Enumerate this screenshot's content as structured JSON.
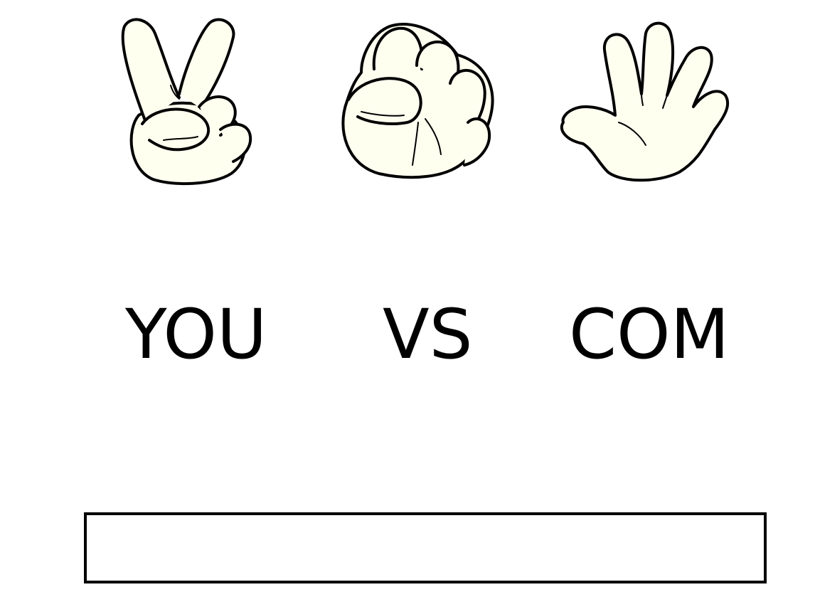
{
  "choices": [
    {
      "id": "scissors",
      "icon": "scissors-hand-icon"
    },
    {
      "id": "rock",
      "icon": "rock-fist-icon"
    },
    {
      "id": "paper",
      "icon": "paper-open-hand-icon"
    }
  ],
  "labels": {
    "you": "YOU",
    "vs": "VS",
    "com": "COM"
  },
  "result": {
    "text": ""
  },
  "colors": {
    "background": "#ffffff",
    "outline": "#000000",
    "glove_fill": "#fffff0",
    "glove_shadow": "#6b6b00"
  }
}
